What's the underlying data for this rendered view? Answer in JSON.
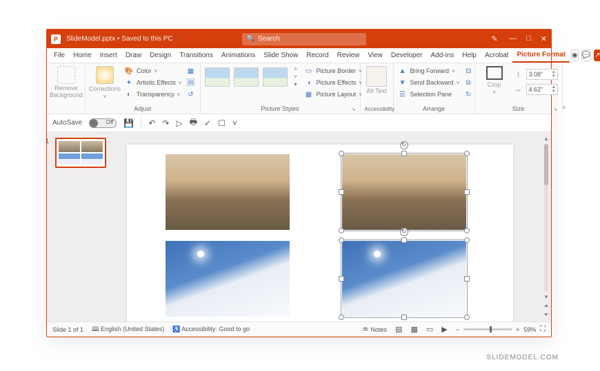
{
  "title": {
    "filename": "SlideModel.pptx",
    "save_state": "Saved to this PC"
  },
  "search": {
    "placeholder": "Search"
  },
  "window_buttons": {
    "min": "—",
    "max": "□",
    "close": "✕"
  },
  "tabs": [
    "File",
    "Home",
    "Insert",
    "Draw",
    "Design",
    "Transitions",
    "Animations",
    "Slide Show",
    "Record",
    "Review",
    "View",
    "Developer",
    "Add-ins",
    "Help",
    "Acrobat",
    "Picture Format"
  ],
  "active_tab": "Picture Format",
  "ribbon": {
    "adjust": {
      "remove_bg": "Remove Background",
      "corrections": "Corrections",
      "color": "Color",
      "artistic": "Artistic Effects",
      "transparency": "Transparency",
      "label": "Adjust"
    },
    "styles": {
      "border": "Picture Border",
      "effects": "Picture Effects",
      "layout": "Picture Layout",
      "label": "Picture Styles"
    },
    "accessibility": {
      "alt": "Alt Text",
      "label": "Accessibility"
    },
    "arrange": {
      "forward": "Bring Forward",
      "backward": "Send Backward",
      "pane": "Selection Pane",
      "label": "Arrange"
    },
    "size": {
      "crop": "Crop",
      "height": "3.08\"",
      "width": "4.62\"",
      "label": "Size"
    }
  },
  "qat": {
    "autosave": "AutoSave",
    "autosave_state": "Off"
  },
  "thumbnail": {
    "index": "1"
  },
  "status": {
    "slide": "Slide 1 of 1",
    "lang": "English (United States)",
    "access": "Accessibility: Good to go",
    "notes": "Notes",
    "zoom": "59%"
  },
  "watermark": "SLIDEMODEL.COM"
}
